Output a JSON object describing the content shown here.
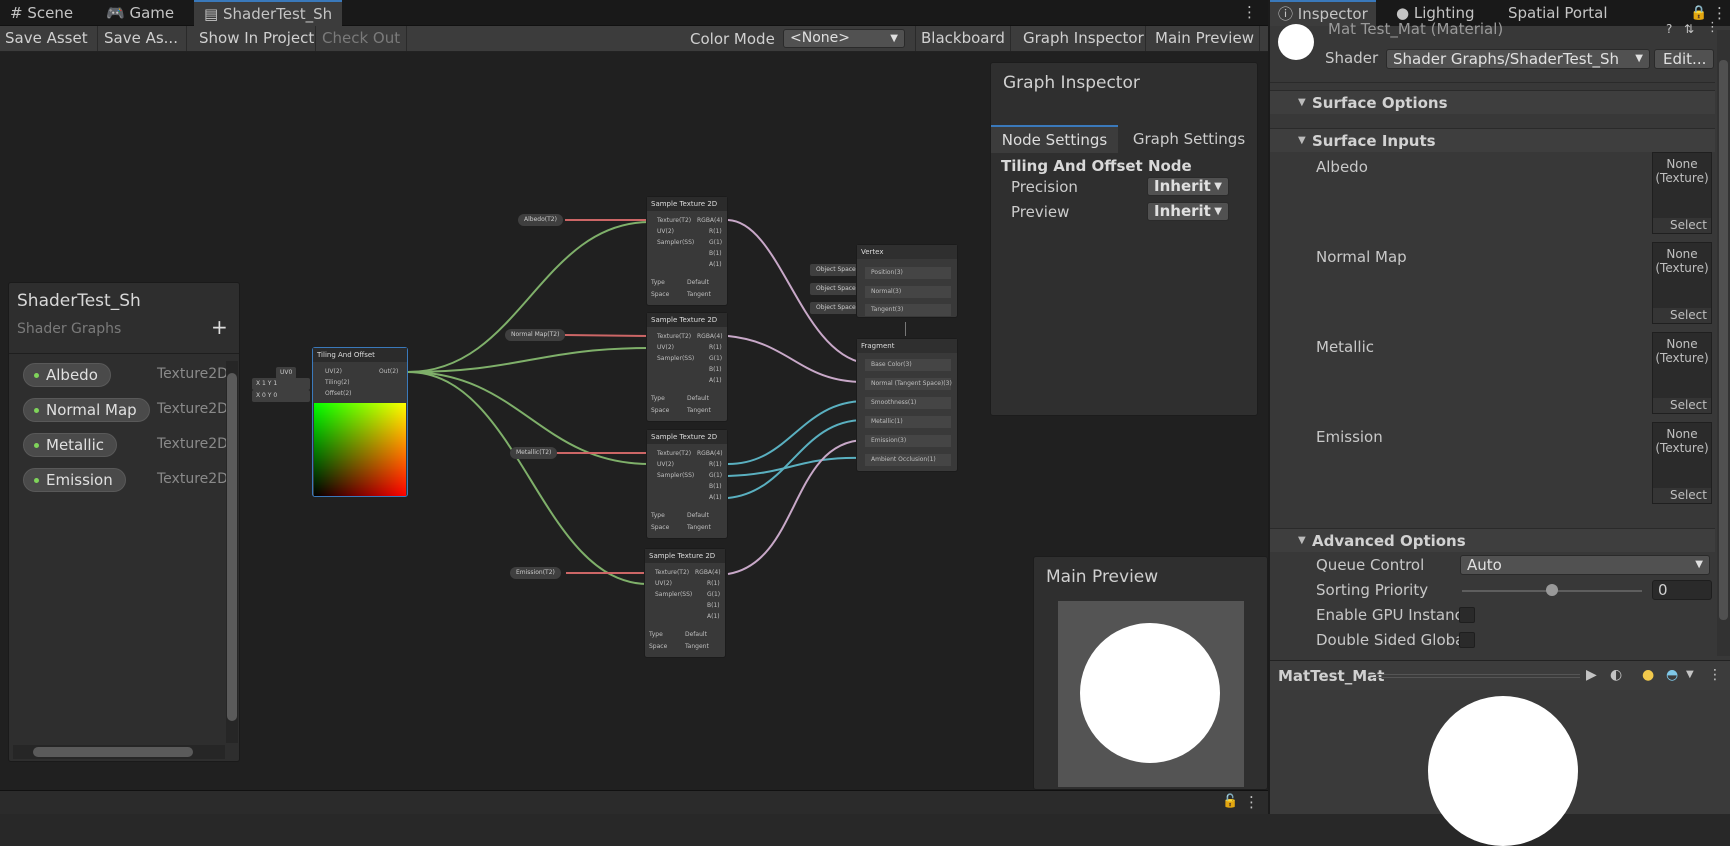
{
  "tabs": [
    {
      "label": "Scene",
      "icon": "hash-icon"
    },
    {
      "label": "Game",
      "icon": "gamepad-icon"
    },
    {
      "label": "ShaderTest_Sh",
      "icon": "shader-icon"
    }
  ],
  "toolbar": {
    "save_asset": "Save Asset",
    "save_as": "Save As...",
    "show_in_project": "Show In Project",
    "check_out": "Check Out",
    "color_mode_label": "Color Mode",
    "color_mode_value": "<None>",
    "blackboard": "Blackboard",
    "graph_inspector": "Graph Inspector",
    "main_preview": "Main Preview"
  },
  "blackboard": {
    "title": "ShaderTest_Sh",
    "subtitle": "Shader Graphs",
    "add": "+",
    "properties": [
      {
        "name": "Albedo",
        "type": "Texture2D"
      },
      {
        "name": "Normal Map",
        "type": "Texture2D"
      },
      {
        "name": "Metallic",
        "type": "Texture2D"
      },
      {
        "name": "Emission",
        "type": "Texture2D"
      }
    ]
  },
  "graph_inspector": {
    "title": "Graph Inspector",
    "tabs": [
      "Node Settings",
      "Graph Settings"
    ],
    "node_title": "Tiling And Offset Node",
    "precision_label": "Precision",
    "precision_value": "Inherit",
    "preview_label": "Preview",
    "preview_value": "Inherit"
  },
  "main_preview": {
    "title": "Main Preview"
  },
  "nodes": {
    "tiling": {
      "title": "Tiling And Offset",
      "uv_in": "UV(2)",
      "tiling": "Tiling(2)",
      "offset": "Offset(2)",
      "out": "Out(2)",
      "uv_chip": "UV0",
      "x1": "X",
      "v1": "1",
      "y1": "Y",
      "v2": "1",
      "x2": "X",
      "v3": "0",
      "y2": "Y",
      "v4": "0"
    },
    "sample": {
      "title": "Sample Texture 2D",
      "tex": "Texture(T2)",
      "uv": "UV(2)",
      "sampler": "Sampler(SS)",
      "rgba": "RGBA(4)",
      "r": "R(1)",
      "g": "G(1)",
      "b": "B(1)",
      "a": "A(1)",
      "type": "Type",
      "type_val": "Default",
      "space": "Space",
      "space_val": "Tangent"
    },
    "props": [
      "Albedo(T2)",
      "Normal Map(T2)",
      "Metallic(T2)",
      "Emission(T2)"
    ],
    "vertex": {
      "title": "Vertex",
      "position": "Position(3)",
      "normal": "Normal(3)",
      "tangent": "Tangent(3)",
      "space": "Object Space"
    },
    "fragment": {
      "title": "Fragment",
      "base": "Base Color(3)",
      "normal": "Normal (Tangent Space)(3)",
      "smooth": "Smoothness(1)",
      "metallic": "Metallic(1)",
      "emission": "Emission(3)",
      "ao": "Ambient Occlusion(1)"
    }
  },
  "inspector": {
    "tabs": [
      {
        "label": "Inspector",
        "icon": "info-icon"
      },
      {
        "label": "Lighting",
        "icon": "bulb-icon"
      },
      {
        "label": "Spatial Portal",
        "icon": ""
      }
    ],
    "material_title": "Mat Test_Mat (Material)",
    "shader_label": "Shader",
    "shader_value": "Shader Graphs/ShaderTest_Sh",
    "edit": "Edit...",
    "surface_options": "Surface Options",
    "surface_inputs": "Surface Inputs",
    "slots": [
      {
        "label": "Albedo"
      },
      {
        "label": "Normal Map"
      },
      {
        "label": "Metallic"
      },
      {
        "label": "Emission"
      }
    ],
    "slot_none": "None",
    "slot_texture": "(Texture)",
    "slot_select": "Select",
    "advanced": "Advanced Options",
    "queue_label": "Queue Control",
    "queue_value": "Auto",
    "sorting_label": "Sorting Priority",
    "sorting_value": "0",
    "sorting_slider": 0.5,
    "gpu_label": "Enable GPU Instanc",
    "double_label": "Double Sided Globa",
    "preview_name": "MatTest_Mat"
  },
  "colors": {
    "accent": "#3a79bb",
    "green_port": "#7fd45a",
    "pink_port": "#e06a6a"
  }
}
